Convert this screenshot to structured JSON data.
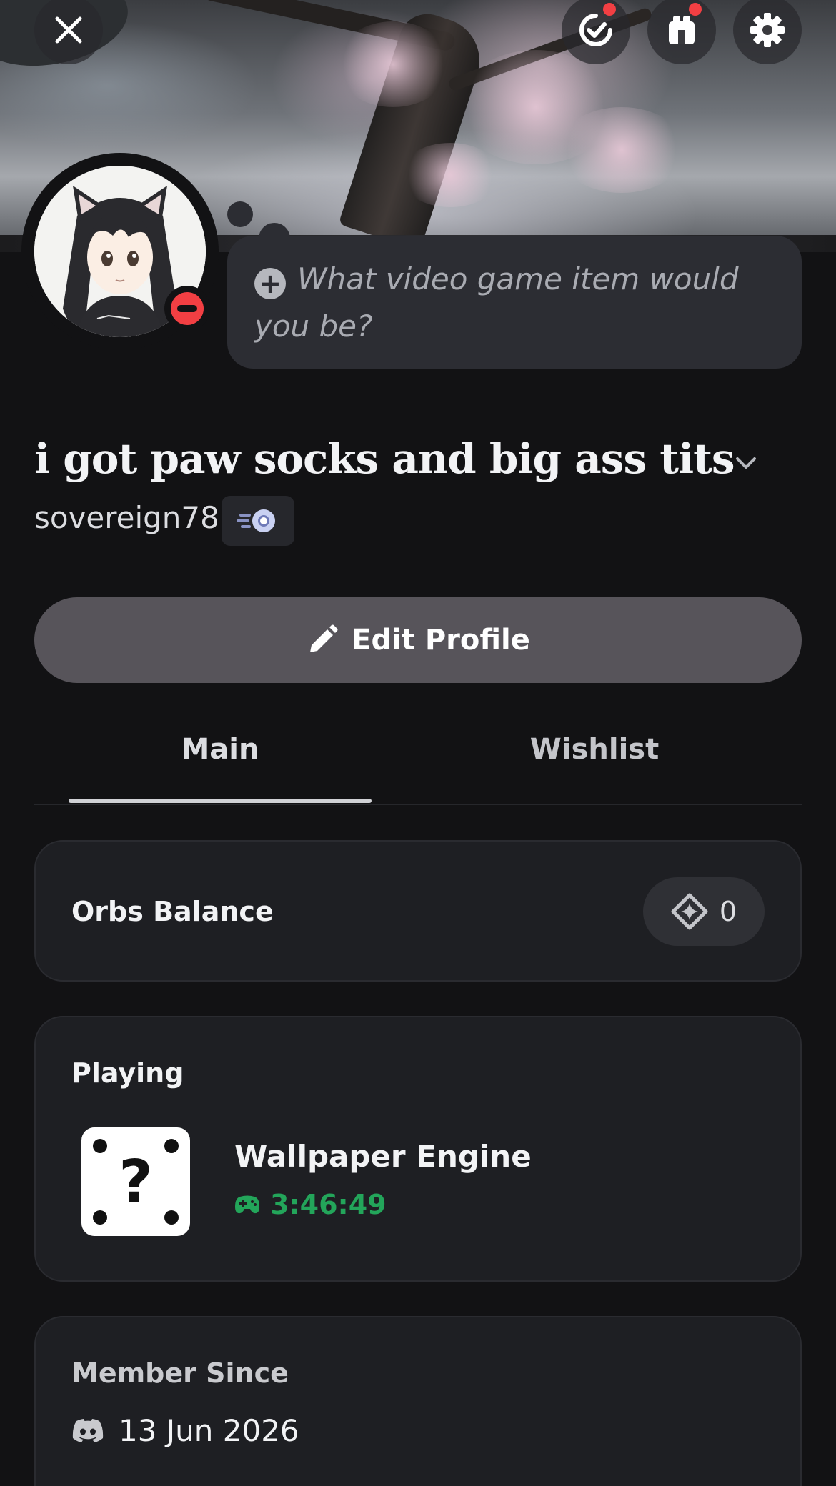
{
  "header": {
    "close_icon": "close-icon",
    "quests_icon": "quest-icon",
    "shop_icon": "shop-icon",
    "settings_icon": "gear-icon",
    "notification_color": "#f23f43"
  },
  "profile": {
    "status_prompt": "What video game item would you be?",
    "display_name": "i got paw socks and big ass tits",
    "username": "sovereign78",
    "presence": "do-not-disturb",
    "presence_color": "#f23f43"
  },
  "actions": {
    "edit_profile_label": "Edit Profile"
  },
  "tabs": [
    {
      "label": "Main",
      "active": true
    },
    {
      "label": "Wishlist",
      "active": false
    }
  ],
  "orbs": {
    "title": "Orbs Balance",
    "value": "0"
  },
  "playing": {
    "title": "Playing",
    "game_name": "Wallpaper Engine",
    "elapsed": "3:46:49",
    "elapsed_color": "#23a55a"
  },
  "member_since": {
    "title": "Member Since",
    "date": "13 Jun 2026"
  }
}
